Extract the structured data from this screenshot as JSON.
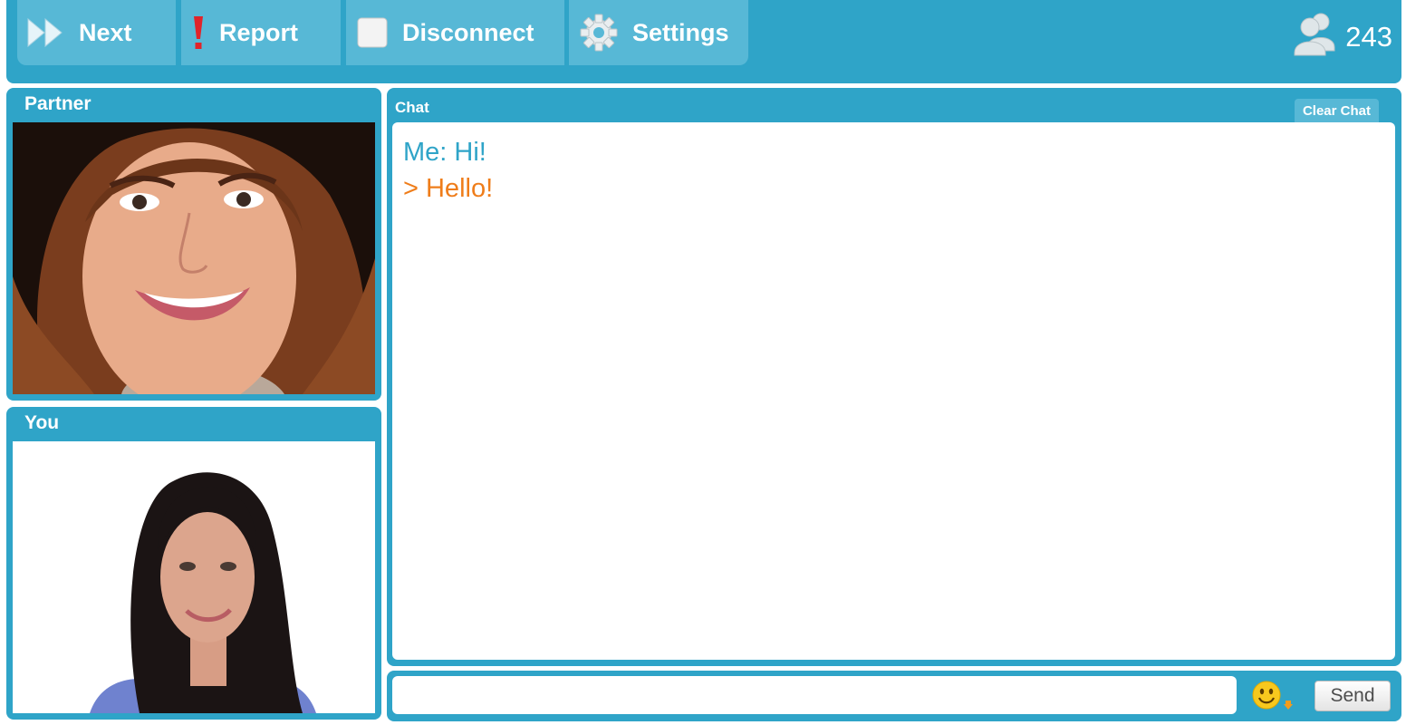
{
  "toolbar": {
    "next_label": "Next",
    "report_label": "Report",
    "disconnect_label": "Disconnect",
    "settings_label": "Settings",
    "online_count": "243"
  },
  "partner": {
    "title": "Partner"
  },
  "you": {
    "title": "You"
  },
  "chat": {
    "title": "Chat",
    "clear_label": "Clear Chat",
    "messages": [
      {
        "text": "Me: Hi!",
        "from": "me"
      },
      {
        "text": "> Hello!",
        "from": "partner"
      }
    ]
  },
  "input": {
    "value": "",
    "placeholder": "",
    "send_label": "Send"
  },
  "colors": {
    "accent": "#2fa4c8",
    "button": "#57b8d6",
    "partner_message": "#ef7d1a",
    "alert": "#e1242a"
  },
  "icons": {
    "next": "fast-forward-icon",
    "report": "exclamation-icon",
    "disconnect": "stop-square-icon",
    "settings": "gear-icon",
    "users": "users-icon",
    "emoji": "smiley-icon"
  }
}
